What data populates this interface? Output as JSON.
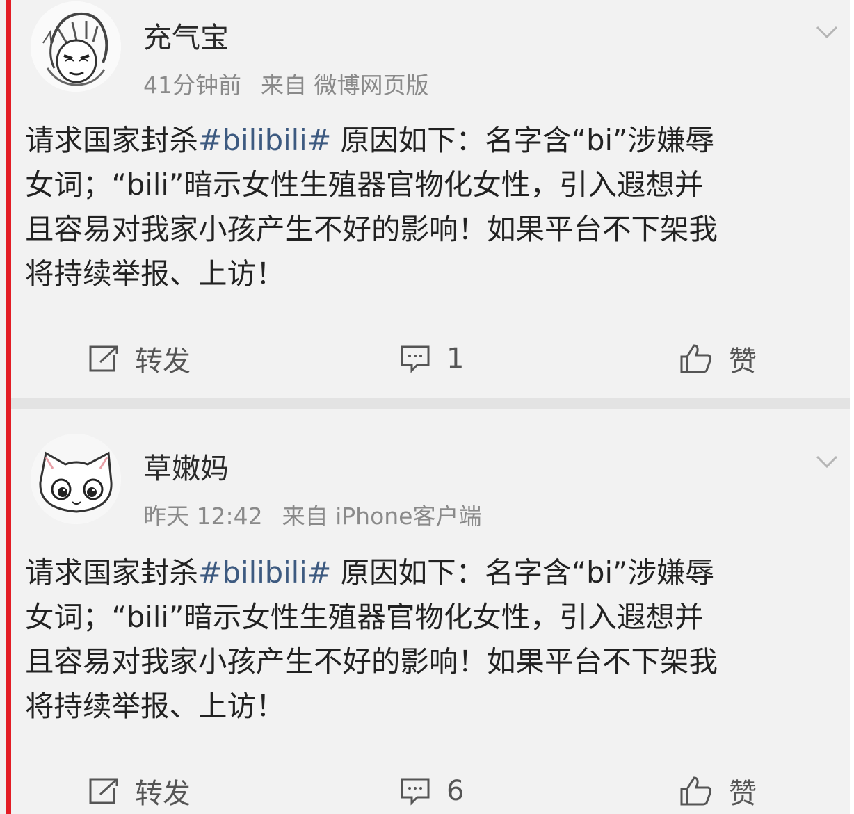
{
  "posts": [
    {
      "username": "充气宝",
      "time": "41分钟前",
      "source": "来自 微博网页版",
      "avatar_icon": "anime-character-avatar-icon",
      "content": {
        "part1": "请求国家封杀",
        "hashtag": "#bilibili#",
        "part2": " 原因如下：名字含“bi”涉嫌辱\n女词；“bili”暗示女性生殖器官物化女性，引入遐想并\n且容易对我家小孩产生不好的影响！如果平台不下架我\n将持续举报、上访！"
      },
      "actions": {
        "repost_label": "转发",
        "comment_count": "1",
        "like_label": "赞"
      }
    },
    {
      "username": "草嫩妈",
      "time": "昨天 12:42",
      "source": "来自 iPhone客户端",
      "avatar_icon": "cartoon-cat-avatar-icon",
      "content": {
        "part1": "请求国家封杀",
        "hashtag": "#bilibili#",
        "part2": " 原因如下：名字含“bi”涉嫌辱\n女词；“bili”暗示女性生殖器官物化女性，引入遐想并\n且容易对我家小孩产生不好的影响！如果平台不下架我\n将持续举报、上访！"
      },
      "actions": {
        "repost_label": "转发",
        "comment_count": "6",
        "like_label": "赞"
      }
    }
  ],
  "colors": {
    "accent_bar": "#e31d25",
    "hashtag": "#3d5a80",
    "meta_text": "#8a8a8a"
  }
}
